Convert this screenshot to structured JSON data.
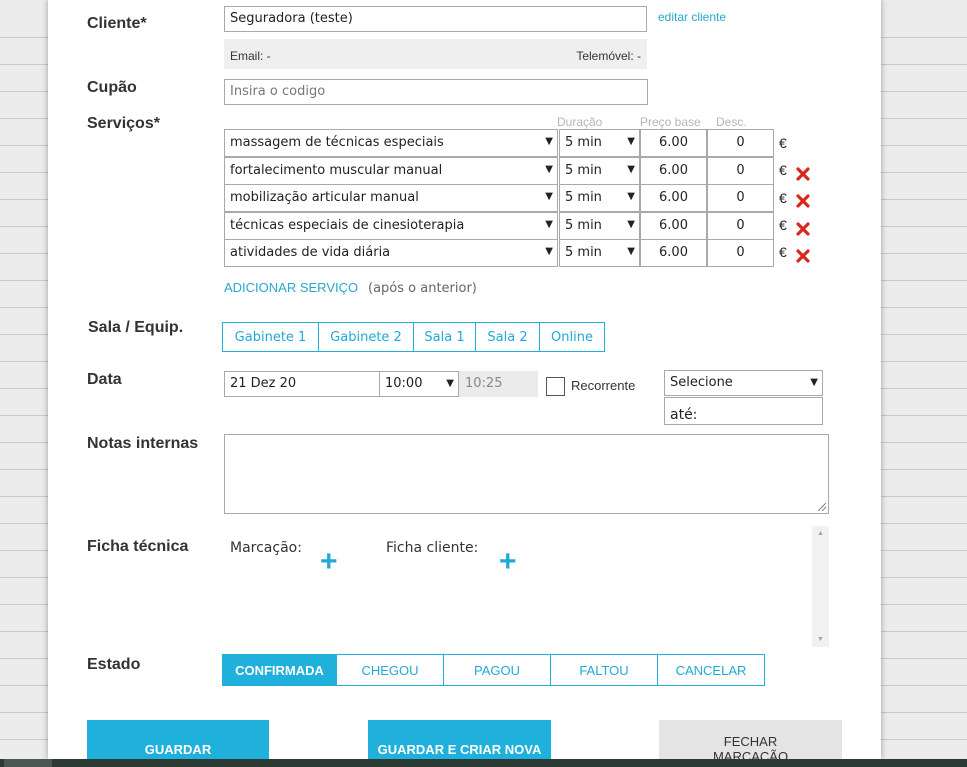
{
  "form": {
    "client": {
      "label": "Cliente*",
      "value": "Seguradora (teste)",
      "edit_link": "editar cliente",
      "email": "Email: -",
      "phone": "Telemóvel: -"
    },
    "coupon": {
      "label": "Cupão",
      "placeholder": "Insira o codigo"
    },
    "services": {
      "label": "Serviços*",
      "headers": {
        "duration": "Duração",
        "base_price": "Preço base",
        "discount": "Desc."
      },
      "rows": [
        {
          "name": "massagem de técnicas especiais",
          "duration": "5 min",
          "price": "6.00",
          "discount": "0",
          "currency": "€"
        },
        {
          "name": "fortalecimento muscular manual",
          "duration": "5 min",
          "price": "6.00",
          "discount": "0",
          "currency": "€"
        },
        {
          "name": "mobilização articular manual",
          "duration": "5 min",
          "price": "6.00",
          "discount": "0",
          "currency": "€"
        },
        {
          "name": "técnicas especiais de cinesioterapia",
          "duration": "5 min",
          "price": "6.00",
          "discount": "0",
          "currency": "€"
        },
        {
          "name": "atividades de vida diária",
          "duration": "5 min",
          "price": "6.00",
          "discount": "0",
          "currency": "€"
        }
      ],
      "add_link": "ADICIONAR SERVIÇO",
      "add_hint": "(após o anterior)"
    },
    "room": {
      "label": "Sala / Equip.",
      "options": [
        "Gabinete 1",
        "Gabinete 2",
        "Sala 1",
        "Sala 2",
        "Online"
      ]
    },
    "date": {
      "label": "Data",
      "date": "21 Dez 20",
      "start": "10:00",
      "end": "10:25",
      "recurring_label": "Recorrente",
      "select": "Selecione",
      "until": "até:"
    },
    "notes": {
      "label": "Notas internas"
    },
    "tech_sheet": {
      "label": "Ficha técnica",
      "booking": "Marcação:",
      "client": "Ficha cliente:"
    },
    "status": {
      "label": "Estado",
      "options": [
        "CONFIRMADA",
        "CHEGOU",
        "PAGOU",
        "FALTOU",
        "CANCELAR"
      ],
      "active": "CONFIRMADA"
    },
    "actions": {
      "save": "GUARDAR",
      "save_new": "GUARDAR E CRIAR NOVA",
      "close": "FECHAR MARCAÇÃO"
    }
  },
  "colors": {
    "accent": "#1fb0dc",
    "delete": "#d9271d"
  }
}
